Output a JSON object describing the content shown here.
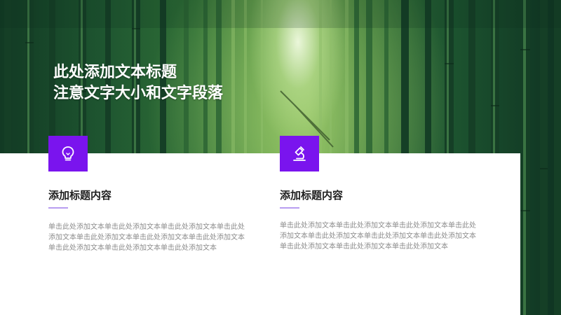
{
  "slide": {
    "title_line1": "此处添加文本标题",
    "title_line2": "注意文字大小和文字段落"
  },
  "columns": [
    {
      "icon": "lightbulb-icon",
      "heading": "添加标题内容",
      "body": "单击此处添加文本单击此处添加文本单击此处添加文本单击此处添加文本单击此处添加文本单击此处添加文本单击此处添加文本单击此处添加文本单击此处添加文本单击此处添加文本"
    },
    {
      "icon": "microscope-icon",
      "heading": "添加标题内容",
      "body": "单击此处添加文本单击此处添加文本单击此处添加文本单击此处添加文本单击此处添加文本单击此处添加文本单击此处添加文本单击此处添加文本单击此处添加文本单击此处添加文本"
    }
  ],
  "colors": {
    "accent": "#7a14ee",
    "divider": "#b79cf0",
    "body_text": "#8c8c8c",
    "heading_text": "#1f1f1f"
  }
}
